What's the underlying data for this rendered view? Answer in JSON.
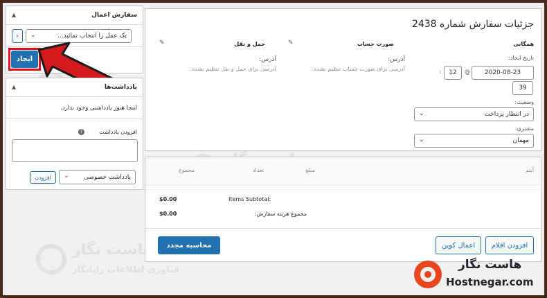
{
  "order_actions": {
    "title": "سفارش اعمال",
    "select_value": "یک عمل را انتخاب نمائید...",
    "go_symbol": "›",
    "create_button": "ایجاد"
  },
  "notes": {
    "title": "یادداشت‌ها",
    "empty_text": "اینجا هنوز یادداشتی وجود ندارد.",
    "add_label": "افزودن یادداشت",
    "help_symbol": "?",
    "note_type": "یادداشت خصوصی",
    "add_button": "افزودن"
  },
  "order": {
    "title": "جزئیات سفارش شماره 2438",
    "general_heading": "همگانی",
    "created_label": "تاریخ ایجاد:",
    "date": "2020-08-23",
    "at": "@",
    "hour": "12",
    "minute": "39",
    "status_label": "وضعیت:",
    "status_value": "در انتظار پرداخت",
    "customer_label": "مشتری:",
    "customer_value": "مهمان",
    "billing_heading": "صورت حساب",
    "billing_address_label": "آدرس:",
    "billing_address_text": "آدرسی برای صورت حساب تنظیم نشده.",
    "shipping_heading": "حمل و نقل",
    "shipping_address_label": "آدرس:",
    "shipping_address_text": "آدرسی برای حمل و نقل تنظیم نشده."
  },
  "items": {
    "col_item": "آیتم",
    "col_price": "مبلغ",
    "col_qty": "تعداد",
    "col_total": "مجموع",
    "subtotal_label": "Items Subtotal:",
    "subtotal_value": "$0.00",
    "order_total_label": "مجموع هزینه سفارش:",
    "order_total_value": "$0.00",
    "add_items_button": "افزودن اقلام",
    "apply_coupon_button": "اعمال کوپن",
    "recalculate_button": "محاسبه مجدد"
  },
  "watermark": {
    "name": "هاست نگار",
    "tagline": "فناوری اطلاعات رایانگار"
  },
  "brand": {
    "name": "هاست نگار",
    "domain": "Hostnegar.com",
    "color": "#e8441d"
  },
  "colors": {
    "highlight_red": "#e0101a",
    "primary_blue": "#2271b1"
  }
}
